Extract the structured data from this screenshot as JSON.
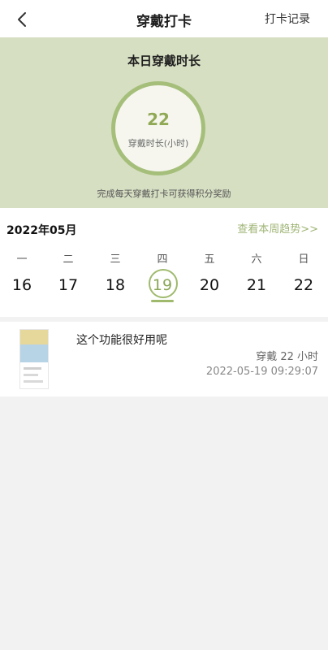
{
  "nav": {
    "title": "穿戴打卡",
    "record_label": "打卡记录"
  },
  "hero": {
    "heading": "本日穿戴时长",
    "hours": "22",
    "unit_label": "穿戴时长(小时)",
    "tip": "完成每天穿戴打卡可获得积分奖励"
  },
  "calendar": {
    "month_label": "2022年05月",
    "trend_link": "查看本周趋势>>",
    "weekdays": [
      "一",
      "二",
      "三",
      "四",
      "五",
      "六",
      "日"
    ],
    "dates": [
      "16",
      "17",
      "18",
      "19",
      "20",
      "21",
      "22"
    ],
    "selected": "19"
  },
  "entry": {
    "comment": "这个功能很好用呢",
    "duration": "穿戴 22 小时",
    "timestamp": "2022-05-19 09:29:07"
  },
  "colors": {
    "accent": "#9fba6d",
    "hero_bg": "#d6dfc2"
  }
}
